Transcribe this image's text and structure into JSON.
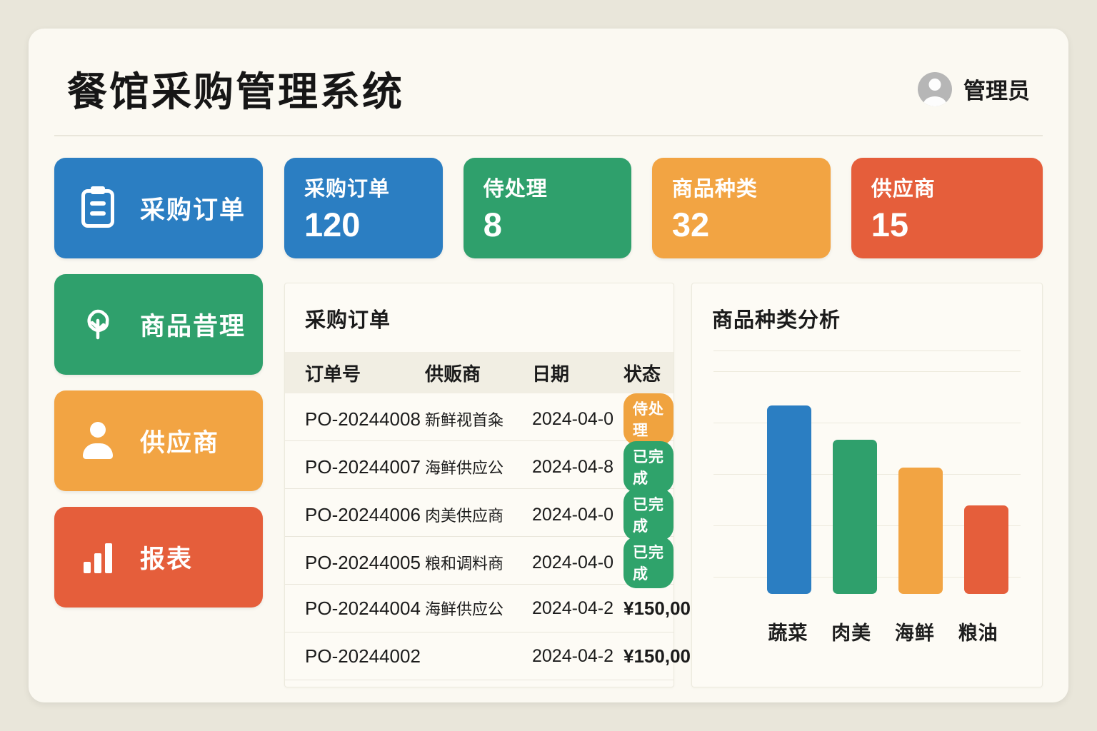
{
  "header": {
    "title": "餐馆采购管理系统",
    "user_name": "管理员"
  },
  "nav": [
    {
      "label": "采购订单",
      "icon": "clipboard-icon",
      "color": "#2b7ec2"
    },
    {
      "label": "商品昔理",
      "icon": "produce-icon",
      "color": "#2fa06c"
    },
    {
      "label": "供应商",
      "icon": "person-icon",
      "color": "#f2a443"
    },
    {
      "label": "报表",
      "icon": "bar-chart-icon",
      "color": "#e55e3b"
    }
  ],
  "stats": [
    {
      "label": "采购订单",
      "value": "120",
      "color": "#2b7ec2"
    },
    {
      "label": "侍处理",
      "value": "8",
      "color": "#2fa06c"
    },
    {
      "label": "商品种类",
      "value": "32",
      "color": "#f2a443"
    },
    {
      "label": "供应商",
      "value": "15",
      "color": "#e55e3b"
    }
  ],
  "orders_panel": {
    "title": "采购订单",
    "columns": [
      "订单号",
      "供贩商",
      "日期",
      "状态"
    ],
    "rows": [
      {
        "order": "PO-20244008",
        "supplier": "新鲜视首粂",
        "date": "2024-04-0",
        "status": {
          "type": "badge",
          "style": "pending",
          "label": "侍处理"
        }
      },
      {
        "order": "PO-20244007",
        "supplier": "海鲜供应公",
        "date": "2024-04-8",
        "status": {
          "type": "badge",
          "style": "done",
          "label": "已完成"
        }
      },
      {
        "order": "PO-20244006",
        "supplier": "肉美供应商",
        "date": "2024-04-0",
        "status": {
          "type": "badge",
          "style": "done",
          "label": "已完成"
        }
      },
      {
        "order": "PO-20244005",
        "supplier": "粮和调料商",
        "date": "2024-04-0",
        "status": {
          "type": "badge",
          "style": "done",
          "label": "已完成"
        }
      },
      {
        "order": "PO-20244004",
        "supplier": "海鲜供应公",
        "date": "2024-04-2",
        "status": {
          "type": "amount",
          "label": "¥150,00"
        }
      },
      {
        "order": "PO-20244002",
        "supplier": "",
        "date": "2024-04-2",
        "status": {
          "type": "amount",
          "label": "¥150,00"
        }
      }
    ]
  },
  "chart_panel": {
    "title": "商品种类分析"
  },
  "chart_data": {
    "type": "bar",
    "title": "商品种类分析",
    "categories": [
      "蔬菜",
      "肉美",
      "海鲜",
      "粮油"
    ],
    "values": [
      100,
      82,
      67,
      47
    ],
    "xlabel": "",
    "ylabel": "",
    "ylim": [
      0,
      110
    ],
    "grid": true,
    "legend": false,
    "bar_colors": [
      "#2b7ec2",
      "#2fa06c",
      "#f2a443",
      "#e55e3b"
    ]
  },
  "colors": {
    "page_bg": "#e9e6da",
    "card_bg": "#fbf9f2",
    "panel_bg": "#fdfbf5",
    "blue": "#2b7ec2",
    "green": "#2fa06c",
    "orange": "#f2a443",
    "red": "#e55e3b",
    "badge_pending": "#f0a33f",
    "badge_done": "#2fa36b",
    "avatar_gray": "#b6b6b6"
  }
}
